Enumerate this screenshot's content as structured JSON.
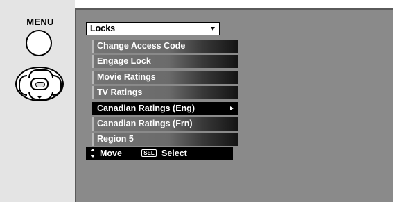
{
  "remote": {
    "menu_label": "MENU"
  },
  "screen": {
    "title": "Locks",
    "items": [
      {
        "label": "Change Access Code",
        "selected": false,
        "has_submenu": false
      },
      {
        "label": "Engage Lock",
        "selected": false,
        "has_submenu": false
      },
      {
        "label": "Movie Ratings",
        "selected": false,
        "has_submenu": false
      },
      {
        "label": "TV Ratings",
        "selected": false,
        "has_submenu": false
      },
      {
        "label": "Canadian Ratings (Eng)",
        "selected": true,
        "has_submenu": true
      },
      {
        "label": "Canadian Ratings (Frn)",
        "selected": false,
        "has_submenu": false
      },
      {
        "label": "Region 5",
        "selected": false,
        "has_submenu": false
      }
    ],
    "help": {
      "move_label": "Move",
      "sel_key": "SEL",
      "select_label": "Select"
    }
  },
  "colors": {
    "screen_bg": "#8a8a8a",
    "selected_bg": "#000000",
    "text": "#ffffff"
  },
  "icons": {
    "menu_button": "circle-button-icon",
    "dpad": "dpad-icon",
    "move": "up-down-arrows-icon",
    "submenu": "right-triangle-icon",
    "dropdown": "down-triangle-icon"
  }
}
